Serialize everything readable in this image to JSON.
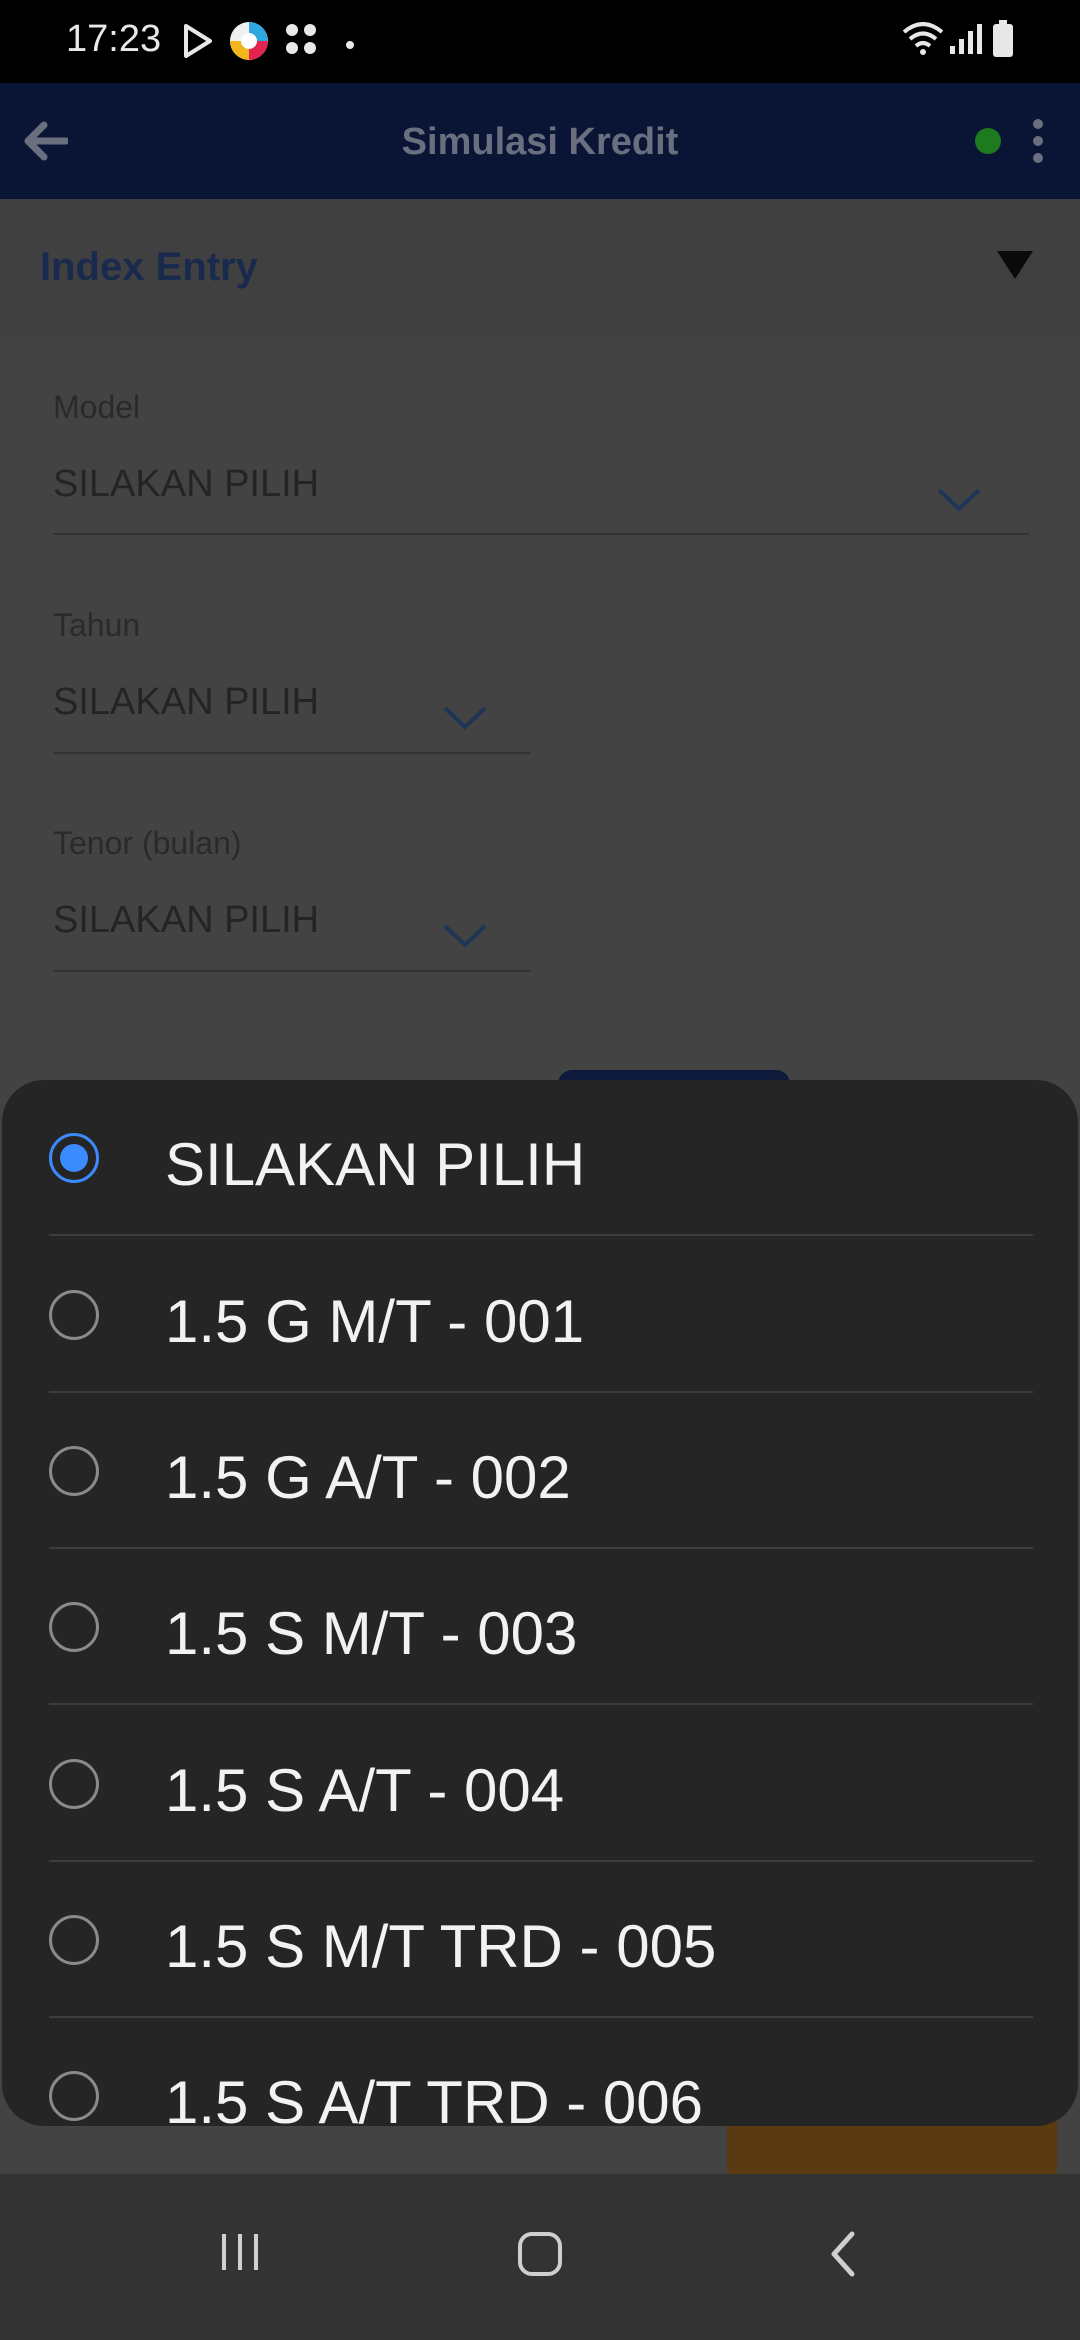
{
  "status_bar": {
    "time": "17:23",
    "icons": [
      "play-store-icon",
      "app-notification-icon",
      "grid-apps-icon",
      "dot-icon",
      "wifi-icon",
      "signal-icon",
      "battery-icon"
    ]
  },
  "app_bar": {
    "title": "Simulasi Kredit",
    "back_icon": "arrow-left-icon",
    "status_dot_color": "#1e7a1e",
    "menu_icon": "more-vertical-icon"
  },
  "section": {
    "title": "Index Entry",
    "toggle_icon": "triangle-down-icon"
  },
  "form": {
    "model": {
      "label": "Model",
      "value": "SILAKAN PILIH"
    },
    "tahun": {
      "label": "Tahun",
      "value": "SILAKAN PILIH"
    },
    "tenor": {
      "label": "Tenor (bulan)",
      "value": "SILAKAN PILIH"
    }
  },
  "picker": {
    "selected_index": 0,
    "options": [
      {
        "label": "SILAKAN PILIH"
      },
      {
        "label": "1.5 G M/T - 001"
      },
      {
        "label": "1.5 G A/T - 002"
      },
      {
        "label": "1.5 S M/T - 003"
      },
      {
        "label": "1.5 S A/T - 004"
      },
      {
        "label": "1.5 S M/T TRD - 005"
      },
      {
        "label": "1.5 S A/T TRD - 006"
      }
    ],
    "accent_color": "#3b8bff"
  },
  "nav_bar": {
    "icons": [
      "recent-apps-icon",
      "home-icon",
      "back-icon"
    ]
  }
}
